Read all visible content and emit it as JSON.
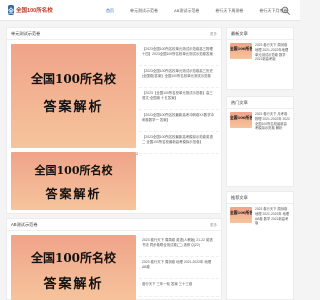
{
  "header": {
    "logo_badge": "全",
    "logo_text": "全国100所名校",
    "nav": [
      "首页",
      "单元测试示范卷",
      "AB测试示范卷",
      "卷行天下周测卷",
      "卷行天下月考卷"
    ],
    "active_index": 0
  },
  "left_top": {
    "title": "单元测试示范卷",
    "more": "更多",
    "image_line1": "全国100所名校",
    "image_line2": "答案解析",
    "items": [
      "【2023全国100所名校单元测试示范卷高三物理十四】2023全国100所名校单元测试示范卷答案",
      "【2023全国100所名校单元测试示范卷高三历史(全国卷)答案】全国100所名校单元测试示范卷",
      "【2023【全国100所名校单元测试示范卷】高三语文·全国卷 十五答案】",
      "【2023全国100所名校最新高考冲刺卷XX数学冲刺卷数学一 答案】",
      "【2023全国100所名校最新高考模拟示范卷英语二 全国100所名校最新高考模拟示范卷】"
    ],
    "caption": "1"
  },
  "left_bottom": {
    "title": "AB测试示范卷",
    "more": "更多",
    "image_line1": "全国100所名校",
    "image_line2": "答案解析",
    "items": [
      "2023 卷行天下 周周卷 英语(人教版) 21-22 英语 书法 同步卷联合测试卷(二) 选修 Q(22)",
      "2023 卷行天下 周测卷 地理 2021-2022年 地理 AB卷",
      "卷行天下 三年一轮 答案 三十三卷"
    ]
  },
  "sidebar": {
    "sections": [
      {
        "title": "最新文章",
        "thumb": "全国100所名校",
        "text": "2023 卷行天下 周测卷 地理 2021-2022年地理单元测试示范卷 数学 2021新高考版"
      },
      {
        "title": "热门文章",
        "thumb": "全国100所名校",
        "text": "2023 卷行天下 月考卷 物理 2021-2022年 2022 全国100所名校最新高考模拟示范卷 解析"
      },
      {
        "title": "推荐文章",
        "thumb": "全国100所名校",
        "text": "2023 卷行天下 周测卷 地理 2021-2022年 地理 AB卷 数学 2021新高考版"
      }
    ]
  }
}
